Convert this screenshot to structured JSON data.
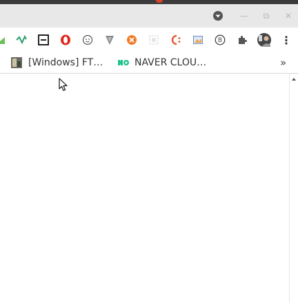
{
  "window": {
    "menu_icon": "dropdown-circle-icon",
    "minimize_glyph": "—",
    "restore_glyph": "⧉",
    "close_glyph": "✕"
  },
  "toolbar": {
    "extensions": [
      {
        "name": "green-chart-icon",
        "color": "#4caf50"
      },
      {
        "name": "wave-icon",
        "color": "#2e9e6b"
      },
      {
        "name": "boxed-letter-icon",
        "color": "#222222"
      },
      {
        "name": "opera-icon",
        "color": "#e0251b"
      },
      {
        "name": "smiley-icon",
        "color": "#555555"
      },
      {
        "name": "v-shield-icon",
        "color": "#888888"
      },
      {
        "name": "orange-circle-icon",
        "color": "#f07c2a"
      },
      {
        "name": "dotted-square-icon",
        "color": "#bdbdbd"
      },
      {
        "name": "c-colon-icon",
        "color": "#e2572f"
      },
      {
        "name": "cast-image-icon",
        "color": "#6a8bbf"
      },
      {
        "name": "bitcoin-circle-icon",
        "color": "#444444"
      },
      {
        "name": "puzzle-icon",
        "color": "#555555"
      }
    ],
    "profile_avatar": "profile-avatar",
    "menu_glyph": "⋮"
  },
  "bookmarks": {
    "items": [
      {
        "label": "[Windows] FT…",
        "icon": "thumbnail-icon"
      },
      {
        "label": "NAVER CLOU…",
        "icon": "naver-cloud-icon"
      }
    ],
    "overflow_glyph": "»"
  }
}
